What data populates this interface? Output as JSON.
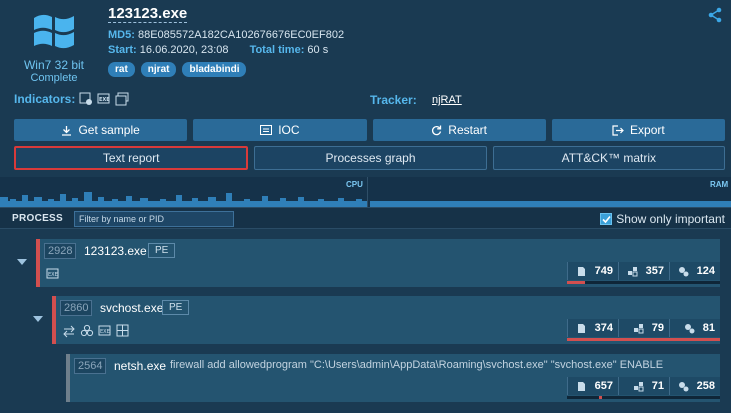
{
  "task": {
    "os_name": "Win7 32 bit",
    "status": "Complete",
    "file_name": "123123.exe",
    "md5_label": "MD5:",
    "md5_value": "88E085572A182CA102676676EC0EF802",
    "start_label": "Start:",
    "start_value": "16.06.2020, 23:08",
    "total_label": "Total time:",
    "total_value": "60 s",
    "tags": [
      "rat",
      "njrat",
      "bladabindi"
    ]
  },
  "indicators_label": "Indicators:",
  "tracker_label": "Tracker:",
  "tracker_value": "njRAT",
  "actions": [
    {
      "label": "Get sample",
      "icon": "download-icon"
    },
    {
      "label": "IOC",
      "icon": "ioc-icon"
    },
    {
      "label": "Restart",
      "icon": "restart-icon"
    },
    {
      "label": "Export",
      "icon": "export-icon"
    }
  ],
  "views": [
    {
      "label": "Text report",
      "highlighted": true
    },
    {
      "label": "Processes graph",
      "highlighted": false
    },
    {
      "label": "ATT&CK™ matrix",
      "highlighted": false
    }
  ],
  "graph": {
    "cpu_label": "CPU",
    "ram_label": "RAM"
  },
  "process_panel": {
    "title": "PROCESS",
    "filter_placeholder": "Filter by name or PID",
    "show_important_label": "Show only important",
    "show_important_checked": true
  },
  "processes": [
    {
      "pid": "2928",
      "name": "123123.exe",
      "badge": "PE",
      "command": "",
      "metrics": {
        "files": "749",
        "registry": "357",
        "modules": "124"
      }
    },
    {
      "pid": "2860",
      "name": "svchost.exe",
      "badge": "PE",
      "command": "",
      "metrics": {
        "files": "374",
        "registry": "79",
        "modules": "81"
      }
    },
    {
      "pid": "2564",
      "name": "netsh.exe",
      "badge": "",
      "command": "firewall add allowedprogram \"C:\\Users\\admin\\AppData\\Roaming\\svchost.exe\" \"svchost.exe\" ENABLE",
      "metrics": {
        "files": "657",
        "registry": "71",
        "modules": "258"
      }
    }
  ],
  "colors": {
    "background": "#1a3a52",
    "accent": "#56b7ec",
    "danger": "#d24f4f",
    "button": "#2a6a98"
  }
}
